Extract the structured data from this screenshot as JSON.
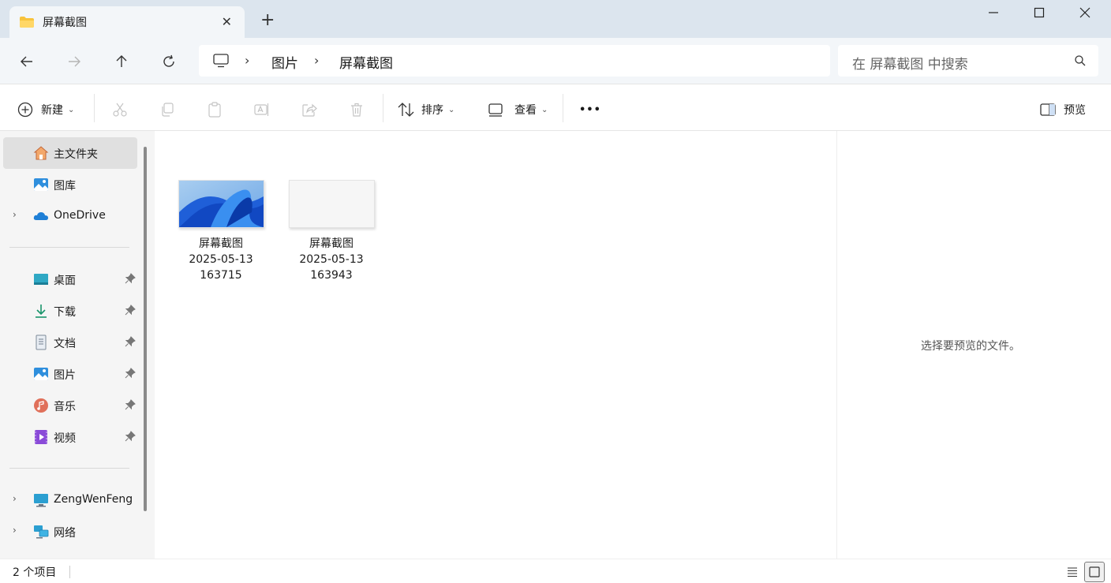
{
  "window": {
    "tab_title": "屏幕截图",
    "tab_close": "✕",
    "new_tab": "+"
  },
  "navigation": {
    "breadcrumbs": [
      "图片",
      "屏幕截图"
    ],
    "search_placeholder": "在 屏幕截图 中搜索"
  },
  "toolbar": {
    "new_label": "新建",
    "sort_label": "排序",
    "view_label": "查看",
    "more_label": "•••",
    "preview_label": "预览"
  },
  "sidebar": {
    "top_items": [
      {
        "label": "主文件夹",
        "icon": "home-icon"
      },
      {
        "label": "图库",
        "icon": "gallery-icon"
      },
      {
        "label": "OneDrive",
        "icon": "cloud-icon"
      }
    ],
    "pinned_items": [
      {
        "label": "桌面",
        "icon": "desktop-icon"
      },
      {
        "label": "下载",
        "icon": "download-icon"
      },
      {
        "label": "文档",
        "icon": "document-icon"
      },
      {
        "label": "图片",
        "icon": "pictures-icon"
      },
      {
        "label": "音乐",
        "icon": "music-icon"
      },
      {
        "label": "视频",
        "icon": "video-icon"
      }
    ],
    "bottom_items": [
      {
        "label": "ZengWenFeng",
        "icon": "computer-icon"
      },
      {
        "label": "网络",
        "icon": "network-icon"
      }
    ]
  },
  "files": [
    {
      "name_line1": "屏幕截图",
      "name_line2": "2025-05-13",
      "name_line3": "163715"
    },
    {
      "name_line1": "屏幕截图",
      "name_line2": "2025-05-13",
      "name_line3": "163943"
    }
  ],
  "preview_pane": {
    "message": "选择要预览的文件。"
  },
  "status": {
    "item_count": "2 个项目"
  },
  "colors": {
    "titlebar": "#dce5ee",
    "navbar": "#f3f6f9",
    "accent": "#0067c0",
    "folder_yellow": "#f8c33c"
  }
}
